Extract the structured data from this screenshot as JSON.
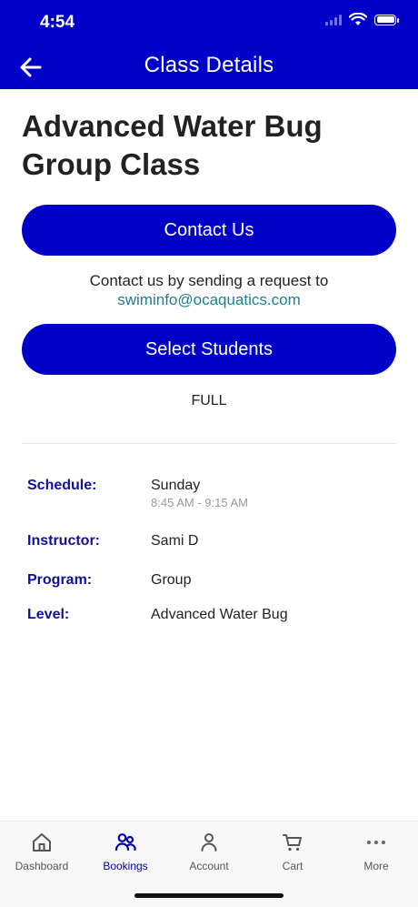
{
  "status_bar": {
    "time": "4:54"
  },
  "header": {
    "title": "Class Details"
  },
  "class": {
    "title": "Advanced Water Bug Group Class"
  },
  "actions": {
    "contact_label": "Contact Us",
    "contact_note": "Contact us by sending a request to",
    "contact_email": "swiminfo@ocaquatics.com",
    "select_label": "Select Students",
    "availability": "FULL"
  },
  "details": {
    "schedule_label": "Schedule:",
    "schedule_day": "Sunday",
    "schedule_time": "8:45 AM - 9:15 AM",
    "instructor_label": "Instructor:",
    "instructor_value": "Sami D",
    "program_label": "Program:",
    "program_value": "Group",
    "level_label": "Level:",
    "level_value": "Advanced Water Bug"
  },
  "tabs": [
    {
      "label": "Dashboard",
      "icon": "home-icon"
    },
    {
      "label": "Bookings",
      "icon": "people-icon",
      "active": true
    },
    {
      "label": "Account",
      "icon": "person-icon"
    },
    {
      "label": "Cart",
      "icon": "cart-icon"
    },
    {
      "label": "More",
      "icon": "more-icon"
    }
  ],
  "colors": {
    "brand": "#0000c8",
    "label": "#10109a",
    "link": "#1b7f8f"
  }
}
